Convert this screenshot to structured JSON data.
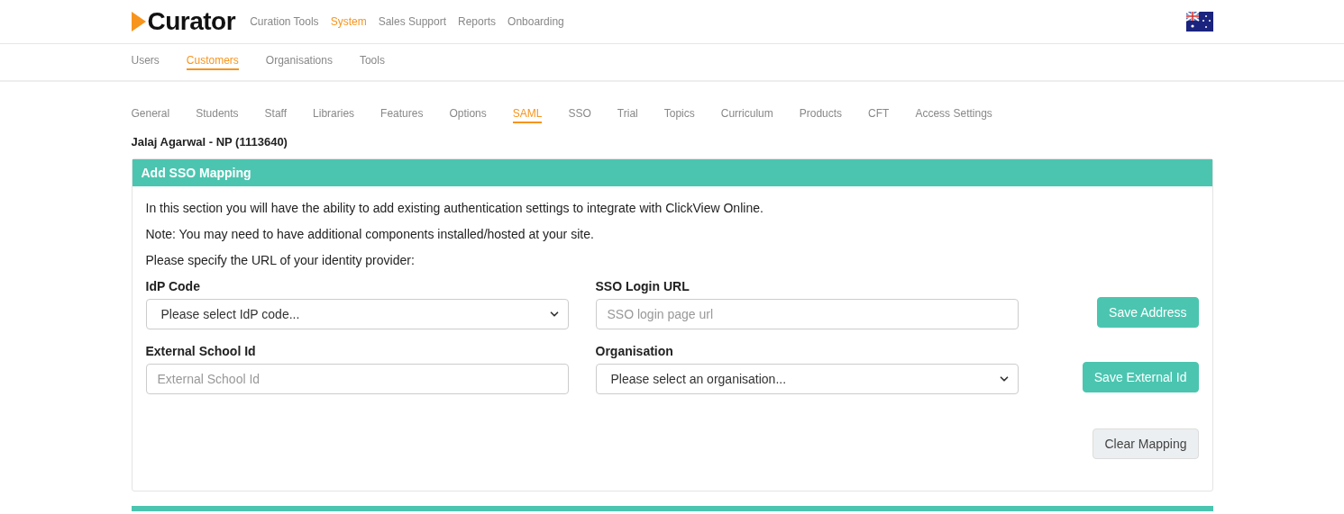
{
  "brand": {
    "name": "Curator"
  },
  "main_nav": [
    {
      "label": "Curation Tools",
      "selected": false
    },
    {
      "label": "System",
      "selected": true
    },
    {
      "label": "Sales Support",
      "selected": false
    },
    {
      "label": "Reports",
      "selected": false
    },
    {
      "label": "Onboarding",
      "selected": false
    }
  ],
  "sub_nav": [
    {
      "label": "Users",
      "selected": false
    },
    {
      "label": "Customers",
      "selected": true
    },
    {
      "label": "Organisations",
      "selected": false
    },
    {
      "label": "Tools",
      "selected": false
    }
  ],
  "tabs": [
    {
      "label": "General",
      "selected": false
    },
    {
      "label": "Students",
      "selected": false
    },
    {
      "label": "Staff",
      "selected": false
    },
    {
      "label": "Libraries",
      "selected": false
    },
    {
      "label": "Features",
      "selected": false
    },
    {
      "label": "Options",
      "selected": false
    },
    {
      "label": "SAML",
      "selected": true
    },
    {
      "label": "SSO",
      "selected": false
    },
    {
      "label": "Trial",
      "selected": false
    },
    {
      "label": "Topics",
      "selected": false
    },
    {
      "label": "Curriculum",
      "selected": false
    },
    {
      "label": "Products",
      "selected": false
    },
    {
      "label": "CFT",
      "selected": false
    },
    {
      "label": "Access Settings",
      "selected": false
    }
  ],
  "customer_name": "Jalaj Agarwal - NP (1113640)",
  "panel": {
    "title": "Add SSO Mapping",
    "paragraphs": [
      "In this section you will have the ability to add existing authentication settings to integrate with ClickView Online.",
      "Note: You may need to have additional components installed/hosted at your site.",
      "Please specify the URL of your identity provider:"
    ],
    "rows": [
      {
        "fields": [
          {
            "label": "IdP Code",
            "kind": "select",
            "value": "Please select IdP code..."
          },
          {
            "label": "SSO Login URL",
            "kind": "input",
            "placeholder": "SSO login page url"
          }
        ],
        "button": {
          "label": "Save Address",
          "kind": "primary"
        }
      },
      {
        "fields": [
          {
            "label": "External School Id",
            "kind": "input",
            "placeholder": "External School Id"
          },
          {
            "label": "Organisation",
            "kind": "select",
            "value": "Please select an organisation..."
          }
        ],
        "button": {
          "label": "Save External Id",
          "kind": "primary"
        }
      }
    ],
    "clear_button": {
      "label": "Clear Mapping",
      "kind": "secondary"
    }
  }
}
